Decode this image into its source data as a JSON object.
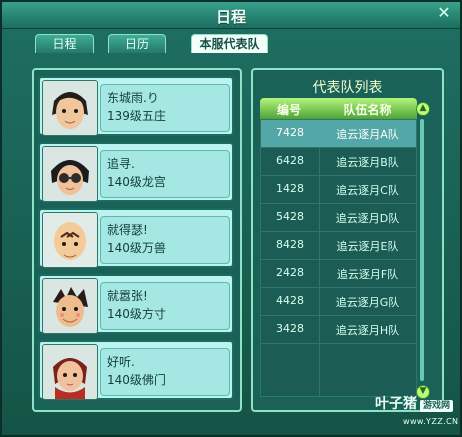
{
  "window": {
    "title": "日程"
  },
  "tabs": [
    {
      "label": "日程"
    },
    {
      "label": "日历"
    },
    {
      "label": "本服代表队"
    }
  ],
  "members": [
    {
      "name": "东城雨.り",
      "level": "139级五庄"
    },
    {
      "name": "追寻.",
      "level": "140级龙宫"
    },
    {
      "name": "就得瑟!",
      "level": "140级万兽"
    },
    {
      "name": "就嚣张!",
      "level": "140级方寸"
    },
    {
      "name": "好听.",
      "level": "140级佛门"
    }
  ],
  "team_list": {
    "title": "代表队列表",
    "headers": [
      "编号",
      "队伍名称"
    ],
    "rows": [
      {
        "id": "7428",
        "name": "追云逐月A队"
      },
      {
        "id": "6428",
        "name": "追云逐月B队"
      },
      {
        "id": "1428",
        "name": "追云逐月C队"
      },
      {
        "id": "5428",
        "name": "追云逐月D队"
      },
      {
        "id": "8428",
        "name": "追云逐月E队"
      },
      {
        "id": "2428",
        "name": "追云逐月F队"
      },
      {
        "id": "4428",
        "name": "追云逐月G队"
      },
      {
        "id": "3428",
        "name": "追云逐月H队"
      }
    ]
  },
  "watermark": {
    "name": "叶子猪",
    "badge": "游戏网",
    "url": "www.YZZ.CN"
  },
  "colors": {
    "accent": "#1a6258",
    "card": "#baf3f0",
    "selected": "#53a7a6"
  }
}
